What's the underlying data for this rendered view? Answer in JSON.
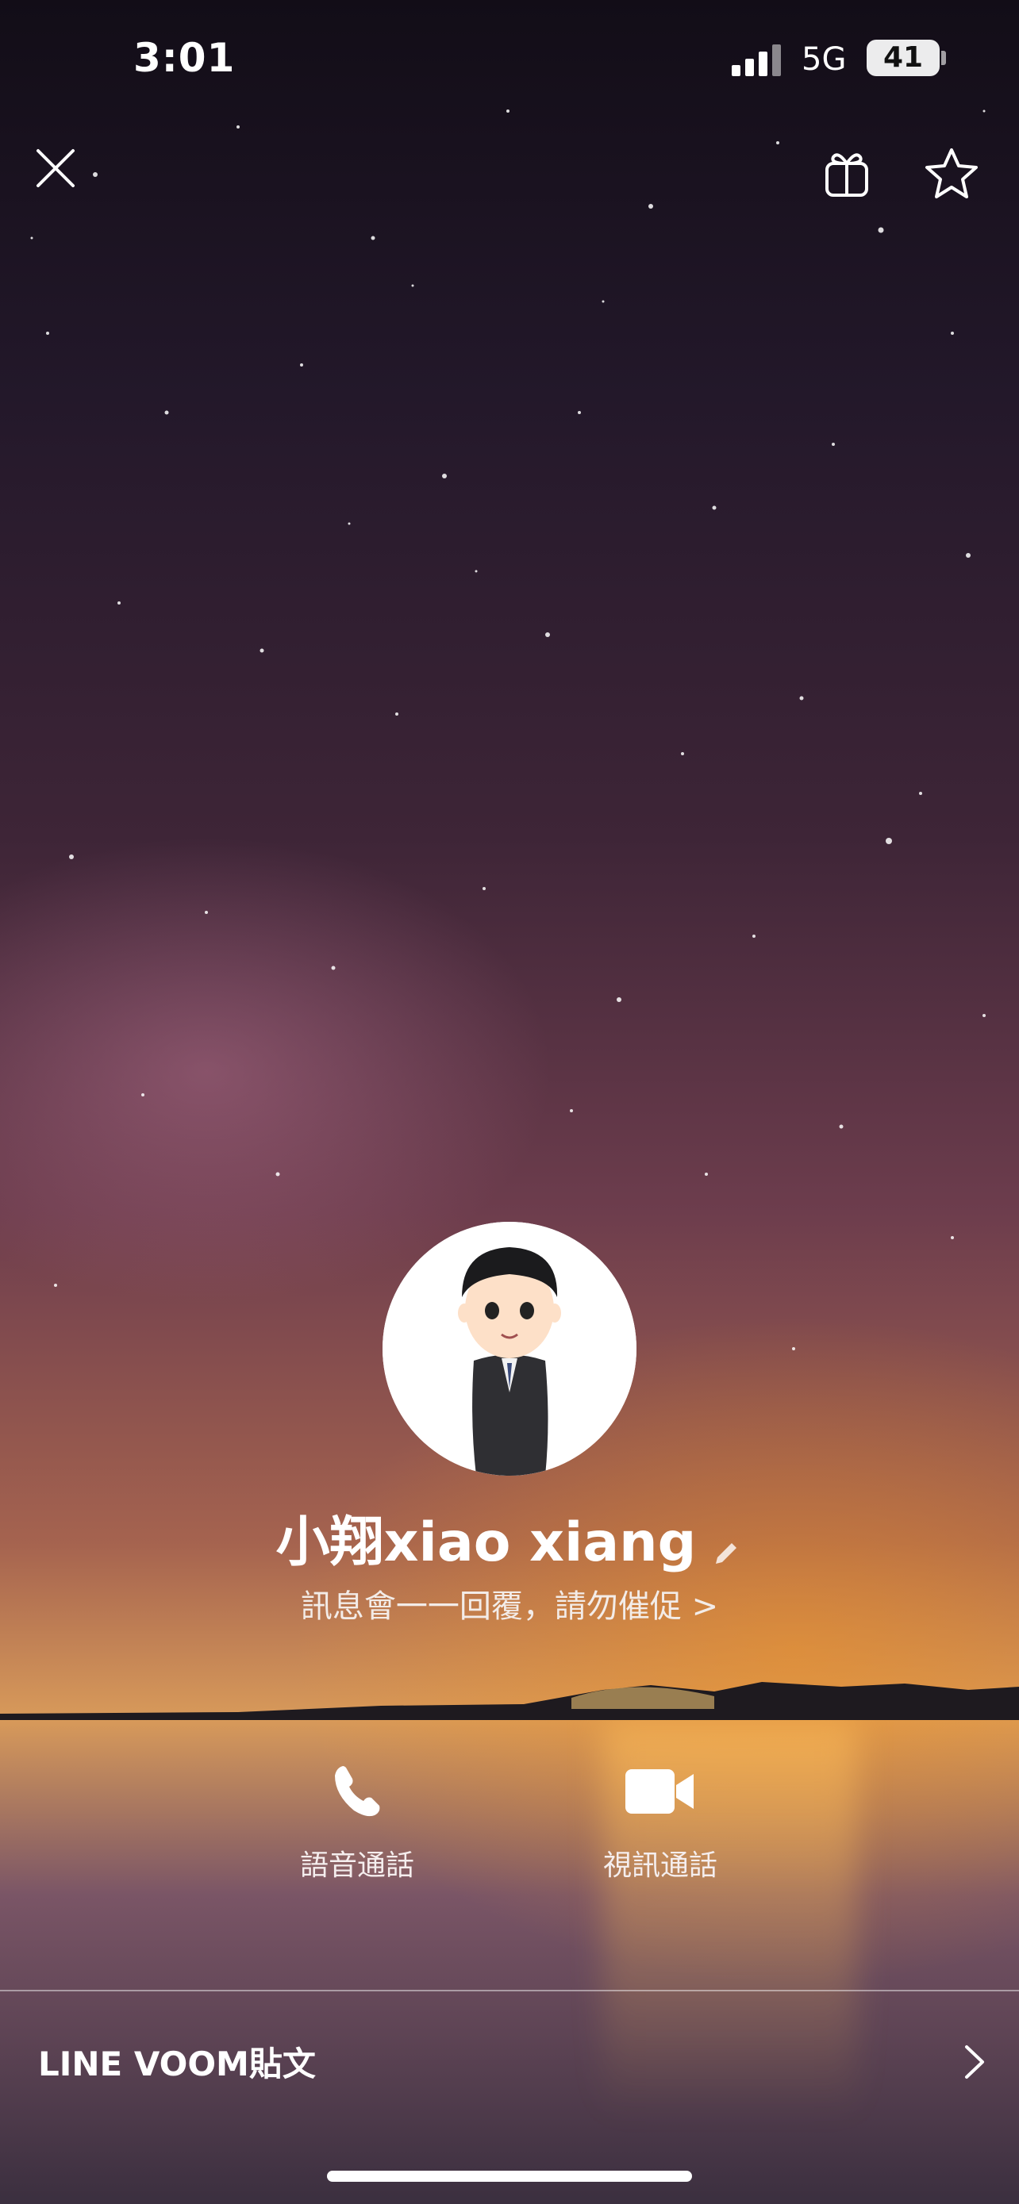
{
  "status_bar": {
    "time": "3:01",
    "network": "5G",
    "battery": "41"
  },
  "top_bar": {
    "close_icon": "close-icon",
    "gift_icon": "gift-icon",
    "star_icon": "star-icon"
  },
  "profile": {
    "name": "小翔xiao xiang",
    "status_message": "訊息會一一回覆，請勿催促 >"
  },
  "actions": {
    "voice_call": "語音通話",
    "video_call": "視訊通話"
  },
  "voom": {
    "label": "LINE VOOM貼文"
  },
  "colors": {
    "text": "#ffffff",
    "divider": "#ffffff"
  }
}
